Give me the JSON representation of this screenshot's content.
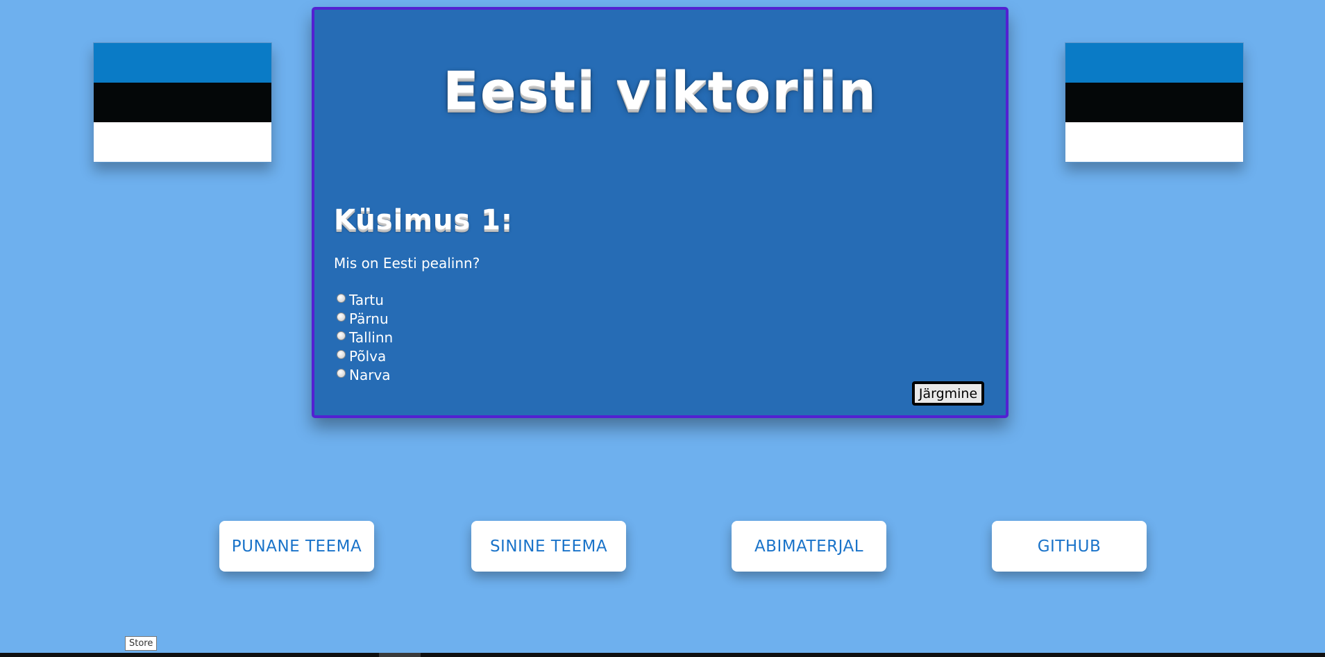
{
  "page": {
    "title": "Eesti viktoriin"
  },
  "flags": {
    "colors": [
      "#0a7bc6",
      "#040708",
      "#ffffff"
    ]
  },
  "quiz": {
    "heading": "Küsimus 1:",
    "question": "Mis on Eesti pealinn?",
    "options": [
      "Tartu",
      "Pärnu",
      "Tallinn",
      "Põlva",
      "Narva"
    ],
    "next_label": "Järgmine"
  },
  "nav": {
    "buttons": [
      {
        "label": "PUNANE TEEMA"
      },
      {
        "label": "SININE TEEMA"
      },
      {
        "label": "ABIMATERJAL"
      },
      {
        "label": "GITHUB"
      }
    ]
  },
  "tooltip": {
    "text": "Store"
  },
  "colors": {
    "background": "#6eb0ee",
    "panel": "#266cb5",
    "panel_border": "#5320d2",
    "button_text": "#1a73c9"
  }
}
